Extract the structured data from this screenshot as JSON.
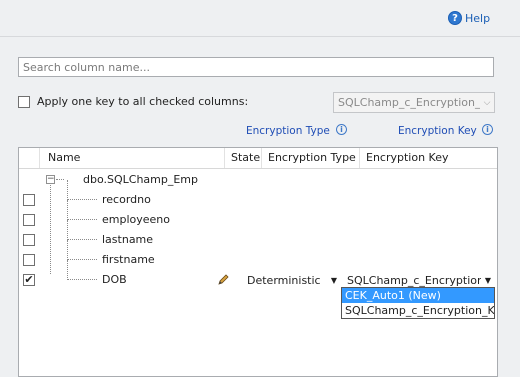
{
  "help": {
    "label": "Help"
  },
  "search": {
    "placeholder": "Search column name..."
  },
  "apply_all": {
    "label": "Apply one key to all checked columns:",
    "checked": false,
    "key_value": "SQLChamp_c_Encryption_"
  },
  "header_links": {
    "encryption_type": "Encryption Type",
    "encryption_key": "Encryption Key"
  },
  "grid": {
    "columns": [
      "Name",
      "State",
      "Encryption Type",
      "Encryption Key"
    ],
    "table_node": "dbo.SQLChamp_Emp",
    "rows": [
      {
        "name": "recordno",
        "checked": false
      },
      {
        "name": "employeeno",
        "checked": false
      },
      {
        "name": "lastname",
        "checked": false
      },
      {
        "name": "firstname",
        "checked": false
      },
      {
        "name": "DOB",
        "checked": true,
        "encryption_type": "Deterministic",
        "encryption_key": "SQLChamp_c_Encryption"
      }
    ]
  },
  "key_dropdown": {
    "options": [
      "CEK_Auto1 (New)",
      "SQLChamp_c_Encryption_Ke"
    ],
    "selected_index": 0
  },
  "icons": {
    "help": "help-circle-icon",
    "info": "info-icon",
    "pencil": "pencil-icon",
    "chevron": "chevron-down-icon"
  }
}
